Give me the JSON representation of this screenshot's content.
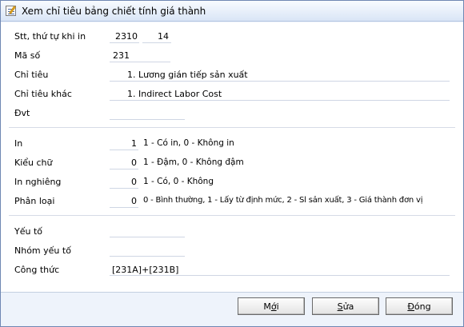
{
  "window": {
    "title": "Xem chỉ tiêu bảng chiết tính giá thành"
  },
  "fields": {
    "stt_label": "Stt, thứ tự khi in",
    "stt_value": "2310",
    "stt_order": "14",
    "ma_so_label": "Mã số",
    "ma_so_value": "231",
    "chi_tieu_label": "Chỉ tiêu",
    "chi_tieu_value": "1. Lương gián tiếp sản xuất",
    "chi_tieu_khac_label": "Chỉ tiêu khác",
    "chi_tieu_khac_value": "1. Indirect Labor Cost",
    "dvt_label": "Đvt",
    "dvt_value": "",
    "in_label": "In",
    "in_value": "1",
    "in_hint": "1 - Có in, 0 - Không in",
    "kieu_chu_label": "Kiểu chữ",
    "kieu_chu_value": "0",
    "kieu_chu_hint": "1 - Đậm, 0 - Không đậm",
    "in_nghieng_label": "In nghiêng",
    "in_nghieng_value": "0",
    "in_nghieng_hint": "1 - Có, 0 - Không",
    "phan_loai_label": "Phân loại",
    "phan_loai_value": "0",
    "phan_loai_hint": "0 - Bình thường, 1 - Lấy từ định mức, 2 - Sl sản xuất, 3 - Giá thành đơn vị",
    "yeu_to_label": "Yếu tố",
    "yeu_to_value": "",
    "nhom_yeu_to_label": "Nhóm yếu tố",
    "nhom_yeu_to_value": "",
    "cong_thuc_label": "Công thức",
    "cong_thuc_value": "[231A]+[231B]"
  },
  "buttons": {
    "moi_pre": "M",
    "moi_u": "ớ",
    "moi_post": "i",
    "sua_pre": "",
    "sua_u": "S",
    "sua_post": "ửa",
    "dong_pre": "",
    "dong_u": "Đ",
    "dong_post": "óng"
  }
}
